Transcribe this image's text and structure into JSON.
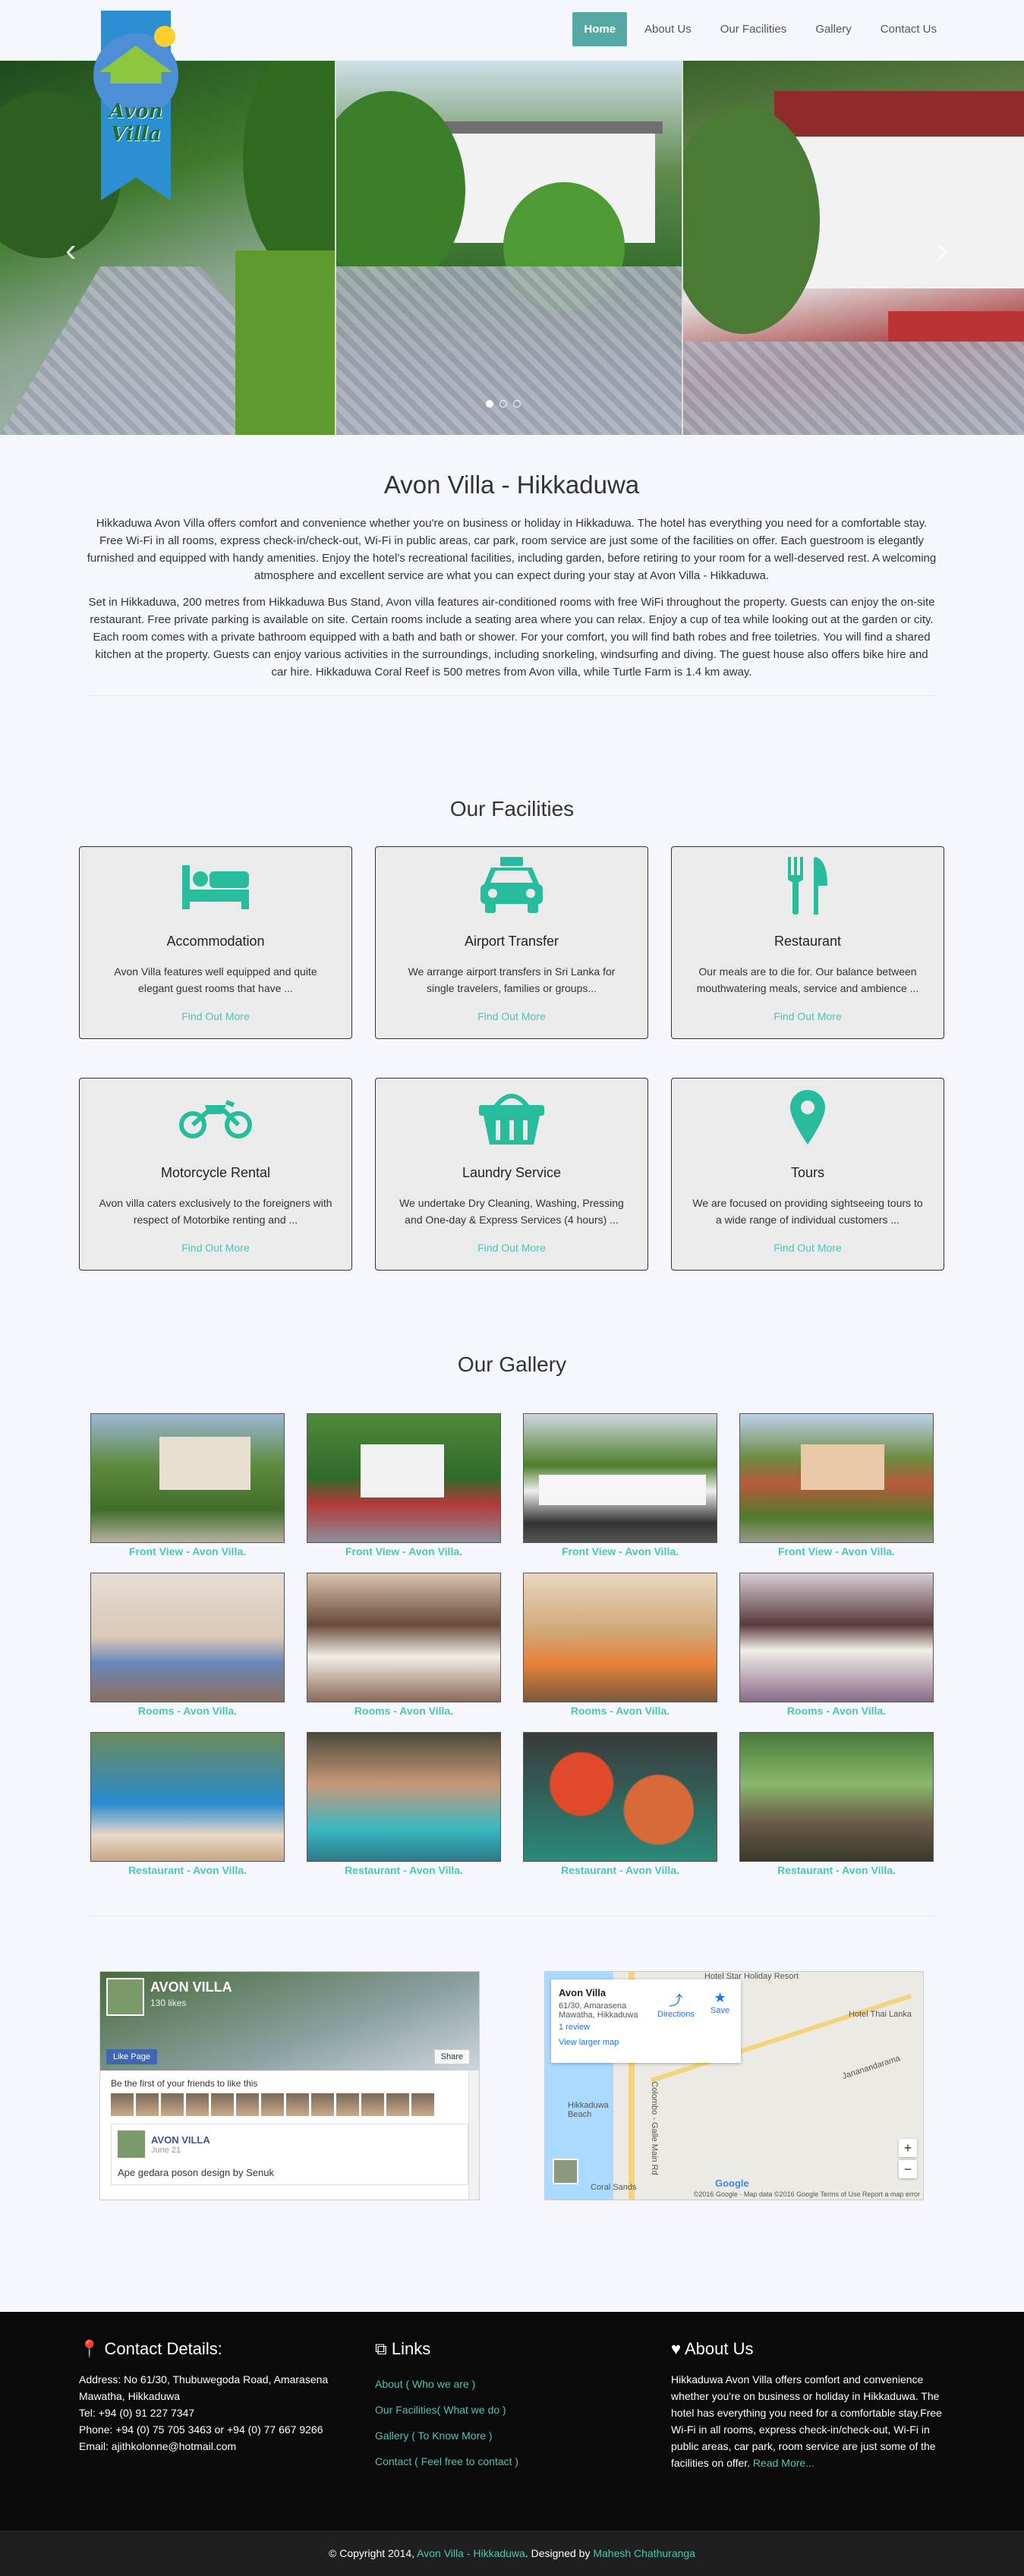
{
  "nav": {
    "items": [
      "Home",
      "About Us",
      "Our Facilities",
      "Gallery",
      "Contact Us"
    ]
  },
  "logo": {
    "text": "Avon Villa"
  },
  "about": {
    "title": "Avon Villa - Hikkaduwa",
    "p1": "Hikkaduwa Avon Villa offers comfort and convenience whether you're on business or holiday in Hikkaduwa. The hotel has everything you need for a comfortable stay. Free Wi-Fi in all rooms, express check-in/check-out, Wi-Fi in public areas, car park, room service are just some of the facilities on offer. Each guestroom is elegantly furnished and equipped with handy amenities. Enjoy the hotel's recreational facilities, including garden, before retiring to your room for a well-deserved rest. A welcoming atmosphere and excellent service are what you can expect during your stay at Avon Villa - Hikkaduwa.",
    "p2": "Set in Hikkaduwa, 200 metres from Hikkaduwa Bus Stand, Avon villa features air-conditioned rooms with free WiFi throughout the property. Guests can enjoy the on-site restaurant. Free private parking is available on site. Certain rooms include a seating area where you can relax. Enjoy a cup of tea while looking out at the garden or city. Each room comes with a private bathroom equipped with a bath and bath or shower. For your comfort, you will find bath robes and free toiletries. You will find a shared kitchen at the property. Guests can enjoy various activities in the surroundings, including snorkeling, windsurfing and diving. The guest house also offers bike hire and car hire. Hikkaduwa Coral Reef is 500 metres from Avon villa, while Turtle Farm is 1.4 km away."
  },
  "facilities": {
    "title": "Our Facilities",
    "link": "Find Out More",
    "accent": "#26bc9c",
    "items": [
      {
        "title": "Accommodation",
        "desc": "Avon Villa features well equipped and quite elegant guest rooms that have ...",
        "icon": "bed-icon"
      },
      {
        "title": "Airport Transfer",
        "desc": "We arrange airport transfers in Sri Lanka for single travelers, families or groups...",
        "icon": "taxi-icon"
      },
      {
        "title": "Restaurant",
        "desc": "Our meals are to die for. Our balance between mouthwatering meals, service and ambience ...",
        "icon": "cutlery-icon"
      },
      {
        "title": "Motorcycle Rental",
        "desc": "Avon villa caters exclusively to the foreigners with respect of Motorbike renting and ...",
        "icon": "motorcycle-icon"
      },
      {
        "title": "Laundry Service",
        "desc": "We undertake Dry Cleaning, Washing, Pressing and One-day & Express Services (4 hours) ...",
        "icon": "basket-icon"
      },
      {
        "title": "Tours",
        "desc": "We are focused on providing sightseeing tours to a wide range of individual customers ...",
        "icon": "map-marker-icon"
      }
    ]
  },
  "gallery": {
    "title": "Our Gallery",
    "captions": [
      "Front View - Avon Villa.",
      "Front View - Avon Villa.",
      "Front View - Avon Villa.",
      "Front View - Avon Villa.",
      "Rooms - Avon Villa.",
      "Rooms - Avon Villa.",
      "Rooms - Avon Villa.",
      "Rooms - Avon Villa.",
      "Restaurant - Avon Villa.",
      "Restaurant - Avon Villa.",
      "Restaurant - Avon Villa.",
      "Restaurant - Avon Villa."
    ]
  },
  "facebook": {
    "name": "AVON VILLA",
    "likes": "130 likes",
    "like_btn": "Like Page",
    "share_btn": "Share",
    "friends_text": "Be the first of your friends to like this",
    "post_name": "AVON VILLA",
    "post_date": "June 21",
    "post_text": "Ape gedara poson design by Senuk"
  },
  "map": {
    "place": "Avon Villa",
    "address": "61/30, Amarasena Mawatha, Hikkaduwa",
    "reviews": "1 review",
    "larger": "View larger map",
    "directions": "Directions",
    "save": "Save",
    "label1": "Hotel Star Holiday Resort",
    "label2": "Hotel Thai Lanka",
    "label3": "Hikkaduwa Beach",
    "label4": "Coral Sands",
    "label5": "Colombo - Galle Main Rd",
    "label6": "Jananandarama",
    "footer": "©2016 Google · Map data ©2016 Google   Terms of Use   Report a map error",
    "google": "Google"
  },
  "footer": {
    "contact_title": "Contact Details:",
    "address": "Address: No 61/30, Thubuwegoda Road, Amarasena Mawatha, Hikkaduwa",
    "tel": "Tel: +94 (0) 91 227 7347",
    "phone": "Phone: +94 (0) 75 705 3463 or +94 (0) 77 667 9266",
    "email": "Email: ajithkolonne@hotmail.com",
    "links_title": "Links",
    "links": [
      "About ( Who we are )",
      "Our Facilities( What we do )",
      "Gallery ( To Know More )",
      "Contact ( Feel free to contact )"
    ],
    "about_title": "About Us",
    "about_text": "Hikkaduwa Avon Villa offers comfort and convenience whether you're on business or holiday in Hikkaduwa. The hotel has everything you need for a comfortable stay.Free Wi-Fi in all rooms, express check-in/check-out, Wi-Fi in public areas, car park, room service are just some of the facilities on offer.",
    "read_more": "Read More..."
  },
  "copyright": {
    "pre": "© Copyright 2014,",
    "site": "Avon Villa - Hikkaduwa",
    "mid": ". Designed by",
    "designer": "Mahesh Chathuranga"
  }
}
